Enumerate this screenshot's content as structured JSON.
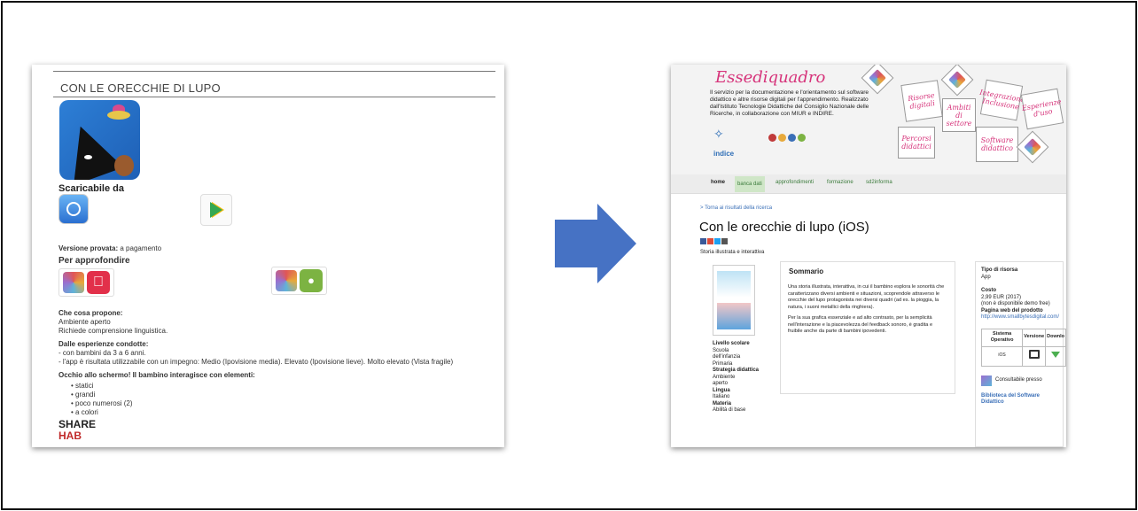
{
  "left": {
    "title": "CON LE ORECCHIE DI LUPO",
    "downloadable_label": "Scaricabile da",
    "tested_version_label": "Versione provata:",
    "tested_version_value": "a pagamento",
    "deepen_label": "Per approfondire",
    "proposal_head": "Che cosa propone:",
    "proposal_lines": [
      "Ambiente aperto",
      "Richiede comprensione linguistica."
    ],
    "experience_head": "Dalle esperienze condotte:",
    "experience_lines": [
      "- con bambini da 3 a 6 anni.",
      "- l'app è risultata utilizzabile con un impegno: Medio (Ipovisione media). Elevato (Ipovisione lieve). Molto elevato (Vista fragile)"
    ],
    "screen_head": "Occhio allo schermo! Il bambino interagisce con elementi:",
    "screen_items": [
      "statici",
      "grandi",
      "poco numerosi (2)",
      "a colori"
    ],
    "logo_share": "SHARE",
    "logo_hab": "HAB"
  },
  "right": {
    "brand": "Essediquadro",
    "banner_desc": "Il servizio per la documentazione e l'orientamento sul software didattico e altre risorse digitali per l'apprendimento. Realizzato dall'Istituto Tecnologie Didattiche del Consiglio Nazionale delle Ricerche, in collaborazione con MIUR e INDIRE.",
    "indice": "indice",
    "cubes": [
      "Risorse digitali",
      "Ambiti di settore",
      "Percorsi didattici",
      "Integrazione Inclusione",
      "Software didattico",
      "Esperienze d'uso"
    ],
    "nav": [
      "home",
      "banca dati",
      "approfondimenti",
      "formazione",
      "sd2informa"
    ],
    "back_link": "> Torna ai risultati della ricerca",
    "page_title": "Con le orecchie di lupo (iOS)",
    "category": "Storia illustrata e interattiva",
    "meta": [
      {
        "label": "Livello scolare",
        "lines": [
          "Scuola",
          "dell'infanzia",
          "Primaria"
        ]
      },
      {
        "label": "Strategia didattica",
        "lines": [
          "Ambiente",
          "aperto"
        ]
      },
      {
        "label": "Lingua",
        "lines": [
          "Italiano"
        ]
      },
      {
        "label": "Materia",
        "lines": [
          "Abilità di base"
        ]
      }
    ],
    "summary_title": "Sommario",
    "summary_p1": "Una storia illustrata, interattiva, in cui il bambino esplora le sonorità che caratterizzano diversi ambienti e situazioni, scoprendole attraverso le orecchie del lupo protagonista nei diversi quadri (ad es. la pioggia, la natura, i suoni metallici della ringhiera).",
    "summary_p2": "Per la sua grafica essenziale e ad alto contrasto, per la semplicità nell'interazione e la piacevolezza del feedback sonoro, è gradita e fruibile anche da parte di bambini ipovedenti.",
    "resource_type_label": "Tipo di risorsa",
    "resource_type_value": "App",
    "cost_label": "Costo",
    "cost_value": "2,99 EUR (2017)",
    "cost_note": "(non è disponibile demo free)",
    "web_label": "Pagina web del prodotto",
    "web_url": "http://www.smallbytesdigital.com/",
    "table_headers": [
      "Sistema Operativo",
      "Versione",
      "Downlo"
    ],
    "table_os": "iOS",
    "consult_label": "Consultabile presso",
    "library": "Biblioteca del Software Didattico"
  },
  "colors": {
    "arrow": "#4672c4",
    "brand_pink": "#d6337a",
    "nav_active": "#cfe6c7",
    "link_blue": "#3a6fb7"
  }
}
